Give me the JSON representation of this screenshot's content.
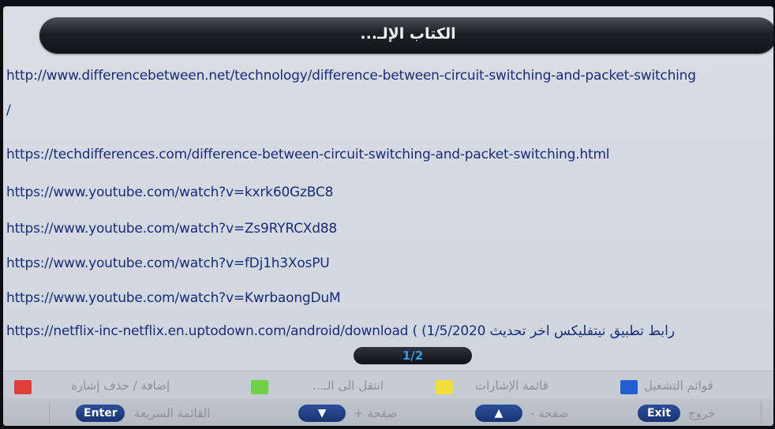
{
  "window": {
    "title": "الكتاب الإلـ..."
  },
  "links": [
    "http://www.differencebetween.net/technology/difference-between-circuit-switching-and-packet-switching",
    "/",
    "https://techdifferences.com/difference-between-circuit-switching-and-packet-switching.html",
    "https://www.youtube.com/watch?v=kxrk60GzBC8",
    "https://www.youtube.com/watch?v=Zs9RYRCXd88",
    "https://www.youtube.com/watch?v=fDj1h3XosPU",
    "https://www.youtube.com/watch?v=KwrbaongDuM",
    "https://netflix-inc-netflix.en.uptodown.com/android/download ( (1/5/2020 رابط تطبيق نيتفليكس اخر تحديث"
  ],
  "pager": {
    "label": "1/2"
  },
  "legend": {
    "red": {
      "label": "إضافة / حذف إشارة",
      "color": "#e0403a"
    },
    "green": {
      "label": "انتقل الى الـ...",
      "color": "#6fd14a"
    },
    "yellow": {
      "label": "قائمة الإشارات",
      "color": "#f0de3a"
    },
    "blue": {
      "label": "قوائم التشغيل",
      "color": "#1f5fd0"
    }
  },
  "footer": {
    "enter_key": "Enter",
    "enter_label": "القائمة السريعة",
    "down_key": "▼",
    "down_label": "صفحة +",
    "up_key": "▲",
    "up_label": "صفحة -",
    "exit_key": "Exit",
    "exit_label": "خروج"
  }
}
